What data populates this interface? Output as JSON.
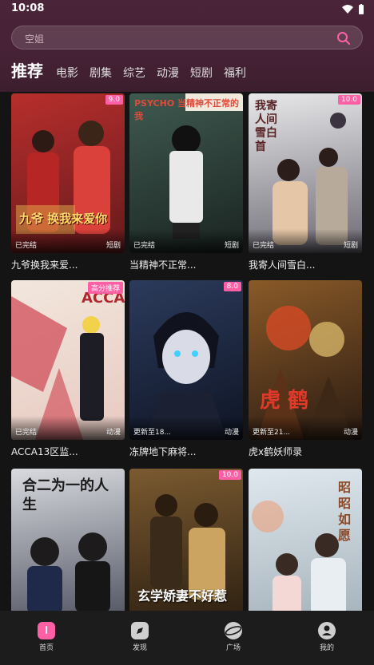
{
  "status_bar": {
    "time": "10:08"
  },
  "search": {
    "placeholder": "空姐"
  },
  "tabs": [
    "推荐",
    "电影",
    "剧集",
    "综艺",
    "动漫",
    "短剧",
    "福利"
  ],
  "cards": [
    {
      "title": "九爷换我来爱...",
      "badge": "9.0",
      "status": "已完结",
      "category": "短剧",
      "poster_text": "九爷 换我来爱你",
      "c1": "#c6302e",
      "c2": "#5a1418"
    },
    {
      "title": "当精神不正常...",
      "badge": "",
      "status": "已完结",
      "category": "短剧",
      "poster_text": "PSYCHO 当精神不正常的我",
      "c1": "#3f5a50",
      "c2": "#1a2420"
    },
    {
      "title": "我寄人间雪白...",
      "badge": "10.0",
      "status": "已完结",
      "category": "短剧",
      "poster_text": "我寄人间雪白首",
      "c1": "#dfe0e2",
      "c2": "#6d6a74"
    },
    {
      "title": "ACCA13区监...",
      "badge": "高分推荐",
      "status": "已完结",
      "category": "动漫",
      "poster_text": "ACCA",
      "c1": "#f2e7dd",
      "c2": "#d25660"
    },
    {
      "title": "冻牌地下麻将...",
      "badge": "8.0",
      "status": "更新至18...",
      "category": "动漫",
      "poster_text": "",
      "c1": "#2c3b5c",
      "c2": "#0e1424"
    },
    {
      "title": "虎x鹤妖师录",
      "badge": "",
      "status": "更新至21...",
      "category": "动漫",
      "poster_text": "虎 鹤",
      "c1": "#8a5a28",
      "c2": "#2a1b12"
    },
    {
      "title": "",
      "badge": "",
      "status": "",
      "category": "",
      "poster_text": "合二为一的人生",
      "c1": "#d8dadf",
      "c2": "#4b4e5c"
    },
    {
      "title": "",
      "badge": "10.0",
      "status": "",
      "category": "",
      "poster_text": "玄学娇妻不好惹",
      "c1": "#7a5a30",
      "c2": "#2a1d10"
    },
    {
      "title": "",
      "badge": "",
      "status": "",
      "category": "",
      "poster_text": "昭昭如愿",
      "c1": "#dfe8ee",
      "c2": "#a3b0b8"
    }
  ],
  "bottom_nav": [
    {
      "label": "首页",
      "icon": "home-icon",
      "active": true
    },
    {
      "label": "发现",
      "icon": "compass-icon",
      "active": false
    },
    {
      "label": "广场",
      "icon": "planet-icon",
      "active": false
    },
    {
      "label": "我的",
      "icon": "profile-icon",
      "active": false
    }
  ],
  "colors": {
    "accent": "#ff5fa5",
    "header": "#4a2438",
    "background": "#141414"
  }
}
